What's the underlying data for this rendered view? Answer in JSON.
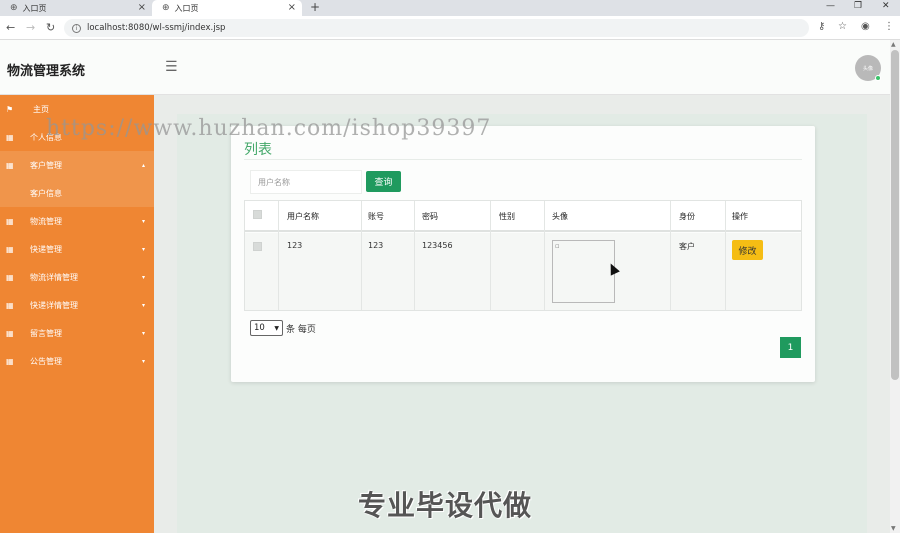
{
  "browser": {
    "tabs": [
      {
        "label": "入口页",
        "active": false
      },
      {
        "label": "入口页",
        "active": true
      }
    ],
    "url": "localhost:8080/wl-ssmj/index.jsp"
  },
  "header": {
    "app_title": "物流管理系统",
    "avatar_text": "头像"
  },
  "sidebar": {
    "items": [
      {
        "label": "主页",
        "icon": "flag-icon",
        "has_caret": false
      },
      {
        "label": "个人信息",
        "icon": "grid-icon",
        "has_caret": false
      },
      {
        "label": "客户管理",
        "icon": "grid-icon",
        "has_caret": true
      },
      {
        "label": "客户信息",
        "icon": "",
        "has_caret": false,
        "sub": true
      },
      {
        "label": "物流管理",
        "icon": "grid-icon",
        "has_caret": true
      },
      {
        "label": "快递管理",
        "icon": "grid-icon",
        "has_caret": true
      },
      {
        "label": "物流详情管理",
        "icon": "grid-icon",
        "has_caret": true
      },
      {
        "label": "快递详情管理",
        "icon": "grid-icon",
        "has_caret": true
      },
      {
        "label": "留言管理",
        "icon": "grid-icon",
        "has_caret": true
      },
      {
        "label": "公告管理",
        "icon": "grid-icon",
        "has_caret": true
      }
    ]
  },
  "main": {
    "card_title": "列表",
    "search": {
      "placeholder": "用户名称",
      "button_label": "查询"
    },
    "table": {
      "columns": [
        "用户名称",
        "账号",
        "密码",
        "性别",
        "头像",
        "身份",
        "操作"
      ],
      "rows": [
        {
          "username": "123",
          "account": "123",
          "password": "123456",
          "gender": "",
          "avatar": "",
          "role": "客户",
          "action_label": "修改"
        }
      ]
    },
    "pagination": {
      "page_size": "10",
      "page_size_label": "条 每页",
      "current_page": "1"
    }
  },
  "watermarks": {
    "url_text": "https://www.huzhan.com/ishop39397",
    "bottom_text": "专业毕设代做"
  },
  "colors": {
    "sidebar": "#ef8633",
    "primary_green": "#1f9a5e",
    "title_green": "#44a86a",
    "edit_yellow": "#f5bd14"
  }
}
